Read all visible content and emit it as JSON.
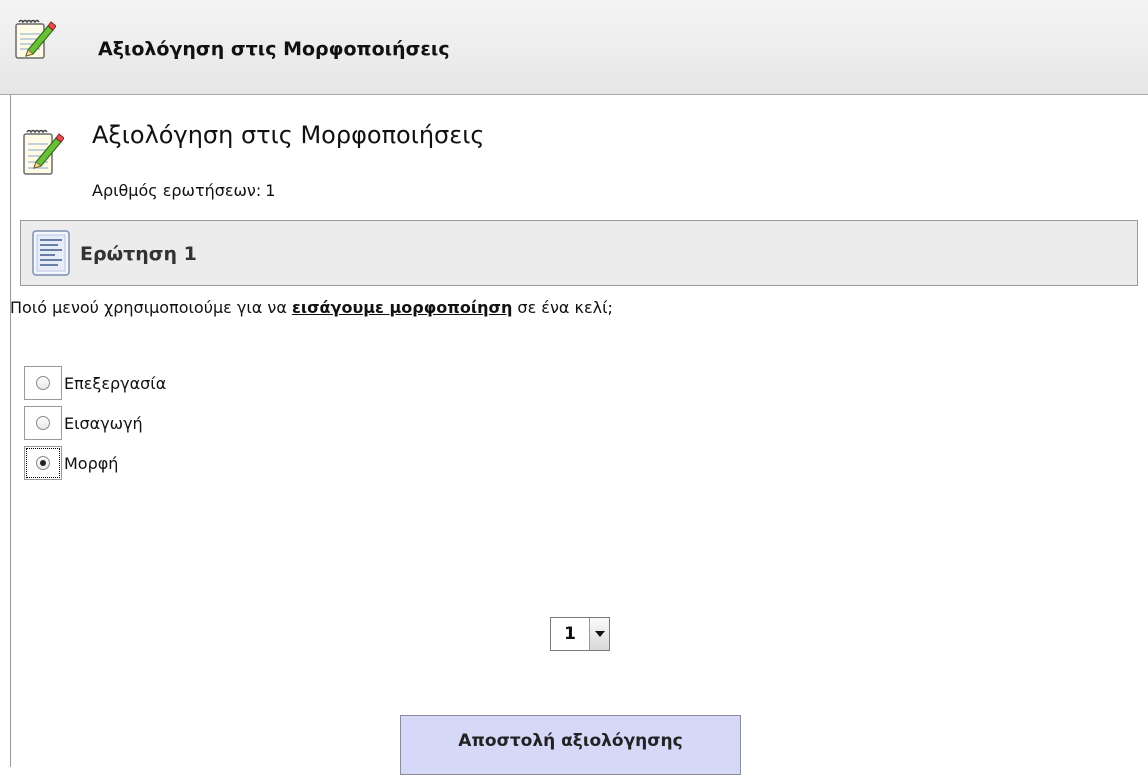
{
  "header": {
    "title": "Αξιολόγηση στις Μορφοποιήσεις",
    "icon": "notepad-pencil-icon"
  },
  "quiz": {
    "title": "Αξιολόγηση στις Μορφοποιήσεις",
    "icon": "notepad-pencil-icon",
    "question_count_label": "Αριθμός ερωτήσεων:",
    "question_count_value": "1"
  },
  "question": {
    "title": "Ερώτηση 1",
    "icon": "document-lines-icon",
    "text_before": "Ποιό μενού χρησιμοποιούμε για να ",
    "text_link": "εισάγουμε μορφοποίηση",
    "text_after": " σε ένα κελί;",
    "options": [
      {
        "label": "Επεξεργασία",
        "selected": false
      },
      {
        "label": "Εισαγωγή",
        "selected": false
      },
      {
        "label": "Μορφή",
        "selected": true
      }
    ]
  },
  "pager": {
    "selected": "1"
  },
  "submit_label": "Αποστολή αξιολόγησης",
  "colors": {
    "submit_bg": "#d6d8f7",
    "question_bar_bg": "#ececec"
  }
}
